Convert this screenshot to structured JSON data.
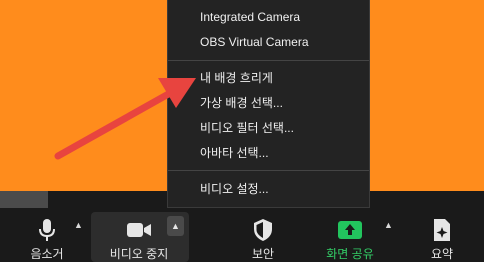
{
  "participant": {
    "name": ""
  },
  "camera_menu": {
    "cameras": [
      "Integrated Camera",
      "OBS Virtual Camera"
    ],
    "background_items": [
      "내 배경 흐리게",
      "가상 배경 선택...",
      "비디오 필터 선택...",
      "아바타 선택..."
    ],
    "settings_label": "비디오 설정..."
  },
  "toolbar": {
    "mute_label": "음소거",
    "stop_video_label": "비디오 중지",
    "security_label": "보안",
    "share_label": "화면 공유",
    "summary_label": "요약"
  },
  "colors": {
    "video_bg": "#ff8c1c",
    "share_green": "#22c55e",
    "arrow_red": "#e8443f"
  }
}
